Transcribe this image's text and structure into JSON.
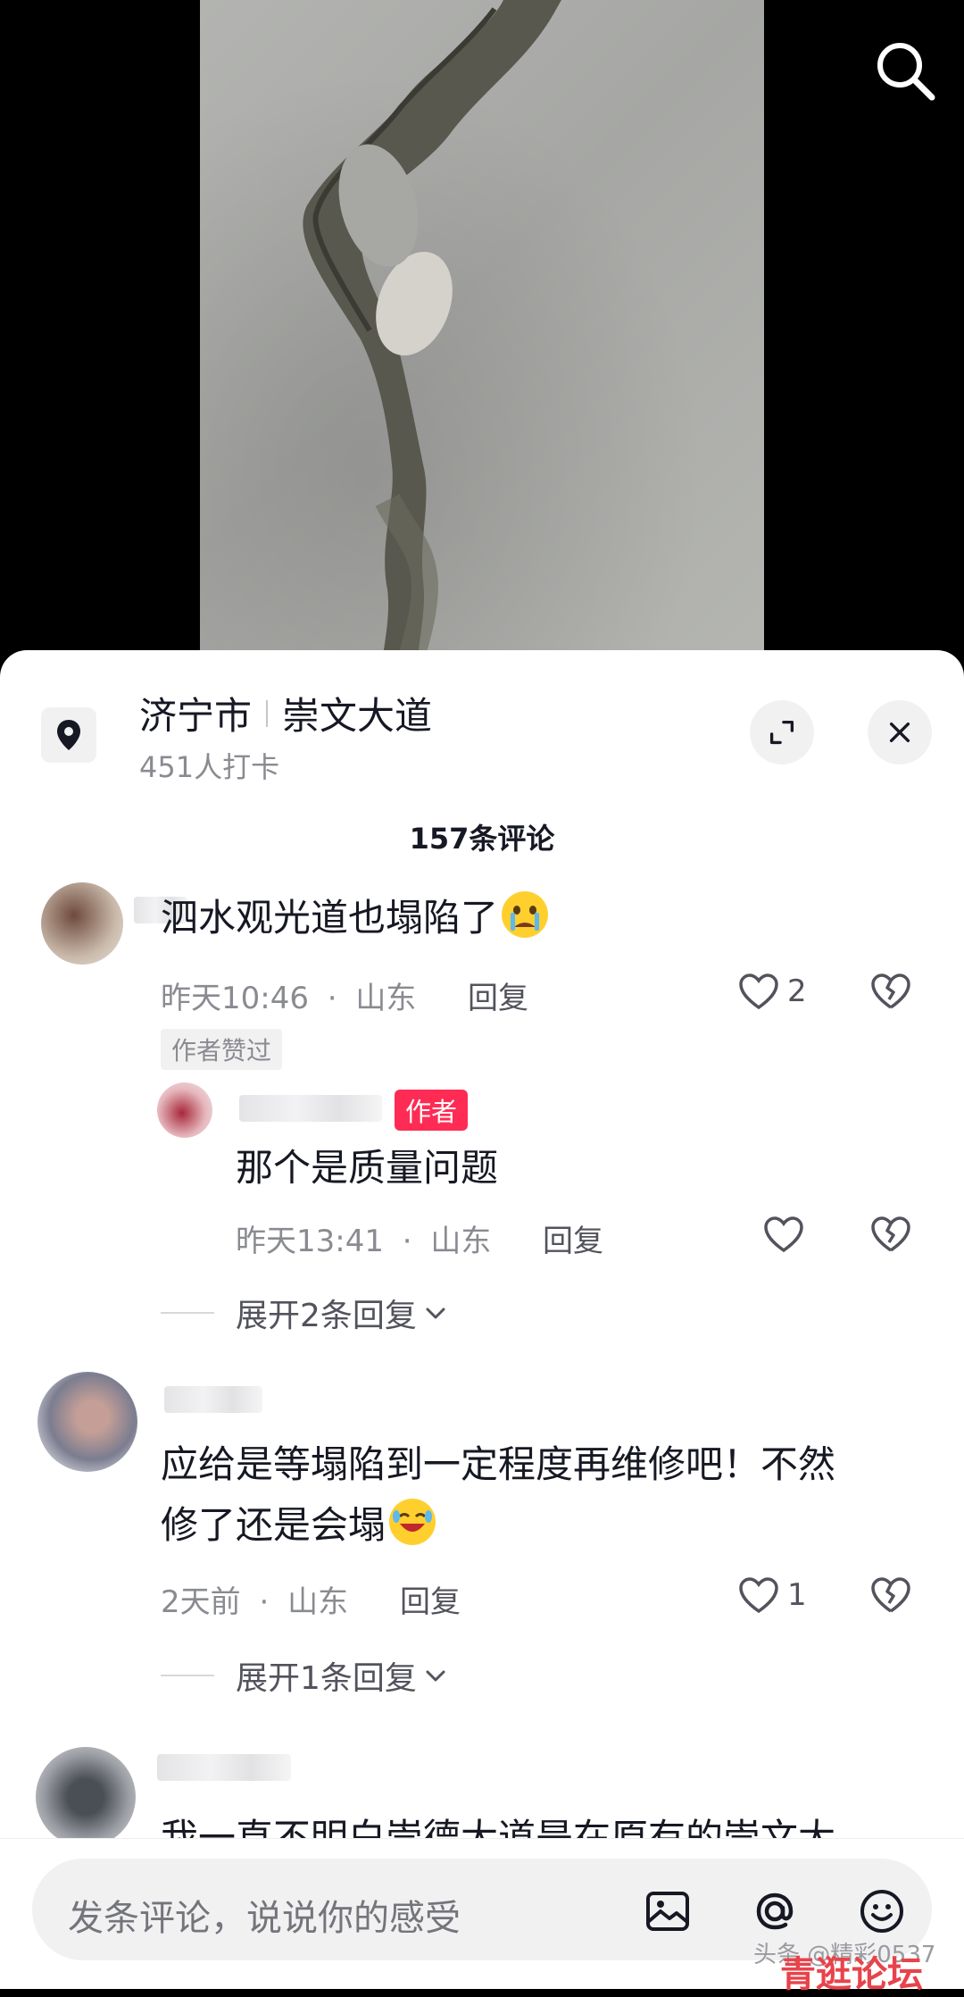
{
  "location": {
    "city": "济宁市",
    "road": "崇文大道",
    "checkins": "451人打卡"
  },
  "comments_header": {
    "count_label": "157条评论"
  },
  "comments": [
    {
      "text": "泗水观光道也塌陷了",
      "time": "昨天10:46",
      "region": "山东",
      "reply_label": "回复",
      "likes": "2",
      "author_liked_tag": "作者赞过",
      "reply": {
        "author_tag": "作者",
        "text": "那个是质量问题",
        "time": "昨天13:41",
        "region": "山东",
        "reply_label": "回复"
      },
      "expand_label": "展开2条回复"
    },
    {
      "text_line1": "应给是等塌陷到一定程度再维修吧！不然",
      "text_line2": "修了还是会塌",
      "time": "2天前",
      "region": "山东",
      "reply_label": "回复",
      "likes": "1",
      "expand_label": "展开1条回复"
    },
    {
      "text": "我一直不明白崇德大道是在原有的崇文大"
    }
  ],
  "separator": "·",
  "input": {
    "placeholder": "发条评论，说说你的感受"
  },
  "watermark": {
    "text": "头条 @精彩0537",
    "logo": "青逛论坛"
  },
  "colors": {
    "accent_red": "#fe2c55",
    "text_primary": "#161823",
    "text_secondary": "#8a8b91"
  }
}
